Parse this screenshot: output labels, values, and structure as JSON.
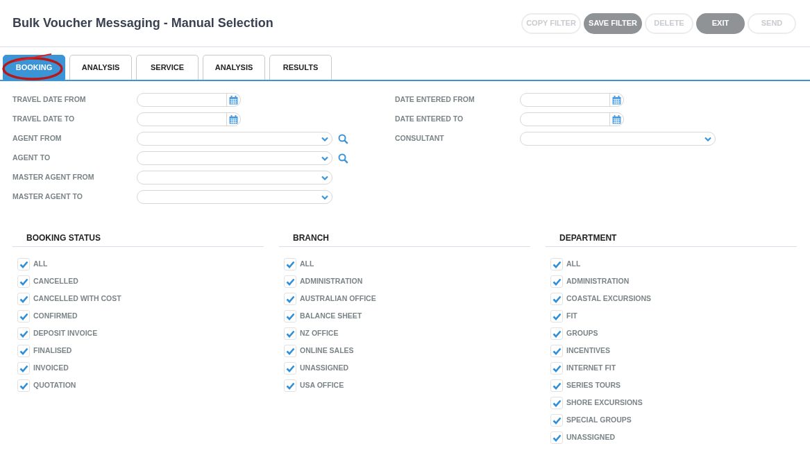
{
  "title": "Bulk Voucher Messaging - Manual Selection",
  "buttons": [
    {
      "label": "COPY FILTER",
      "disabled": true
    },
    {
      "label": "SAVE FILTER",
      "disabled": false
    },
    {
      "label": "DELETE",
      "disabled": true
    },
    {
      "label": "EXIT",
      "disabled": false
    },
    {
      "label": "SEND",
      "disabled": true
    }
  ],
  "tabs": [
    {
      "label": "BOOKING",
      "selected": true
    },
    {
      "label": "ANALYSIS",
      "selected": false
    },
    {
      "label": "SERVICE",
      "selected": false
    },
    {
      "label": "ANALYSIS",
      "selected": false
    },
    {
      "label": "RESULTS",
      "selected": false
    }
  ],
  "left_fields": [
    {
      "label": "TRAVEL DATE FROM",
      "kind": "date",
      "search": false
    },
    {
      "label": "TRAVEL DATE TO",
      "kind": "date",
      "search": false
    },
    {
      "label": "AGENT FROM",
      "kind": "select",
      "search": true
    },
    {
      "label": "AGENT TO",
      "kind": "select",
      "search": true
    },
    {
      "label": "MASTER AGENT FROM",
      "kind": "select",
      "search": false
    },
    {
      "label": "MASTER AGENT TO",
      "kind": "select",
      "search": false
    }
  ],
  "right_fields": [
    {
      "label": "DATE ENTERED FROM",
      "kind": "date",
      "search": false
    },
    {
      "label": "DATE ENTERED TO",
      "kind": "date",
      "search": false
    },
    {
      "label": "CONSULTANT",
      "kind": "select",
      "search": false
    }
  ],
  "groups": [
    {
      "title": "BOOKING STATUS",
      "items": [
        {
          "label": "ALL",
          "checked": true
        },
        {
          "label": "CANCELLED",
          "checked": true
        },
        {
          "label": "CANCELLED WITH COST",
          "checked": true
        },
        {
          "label": "CONFIRMED",
          "checked": true
        },
        {
          "label": "DEPOSIT INVOICE",
          "checked": true
        },
        {
          "label": "FINALISED",
          "checked": true
        },
        {
          "label": "INVOICED",
          "checked": true
        },
        {
          "label": "QUOTATION",
          "checked": true
        }
      ]
    },
    {
      "title": "BRANCH",
      "items": [
        {
          "label": "ALL",
          "checked": true
        },
        {
          "label": "ADMINISTRATION",
          "checked": true
        },
        {
          "label": "AUSTRALIAN OFFICE",
          "checked": true
        },
        {
          "label": "BALANCE SHEET",
          "checked": true
        },
        {
          "label": "NZ OFFICE",
          "checked": true
        },
        {
          "label": "ONLINE SALES",
          "checked": true
        },
        {
          "label": "UNASSIGNED",
          "checked": true
        },
        {
          "label": "USA OFFICE",
          "checked": true
        }
      ]
    },
    {
      "title": "DEPARTMENT",
      "items": [
        {
          "label": "ALL",
          "checked": true
        },
        {
          "label": "ADMINISTRATION",
          "checked": true
        },
        {
          "label": "COASTAL EXCURSIONS",
          "checked": true
        },
        {
          "label": "FIT",
          "checked": true
        },
        {
          "label": "GROUPS",
          "checked": true
        },
        {
          "label": "INCENTIVES",
          "checked": true
        },
        {
          "label": "INTERNET FIT",
          "checked": true
        },
        {
          "label": "SERIES TOURS",
          "checked": true
        },
        {
          "label": "SHORE EXCURSIONS",
          "checked": true
        },
        {
          "label": "SPECIAL GROUPS",
          "checked": true
        },
        {
          "label": "UNASSIGNED",
          "checked": true
        }
      ]
    }
  ]
}
